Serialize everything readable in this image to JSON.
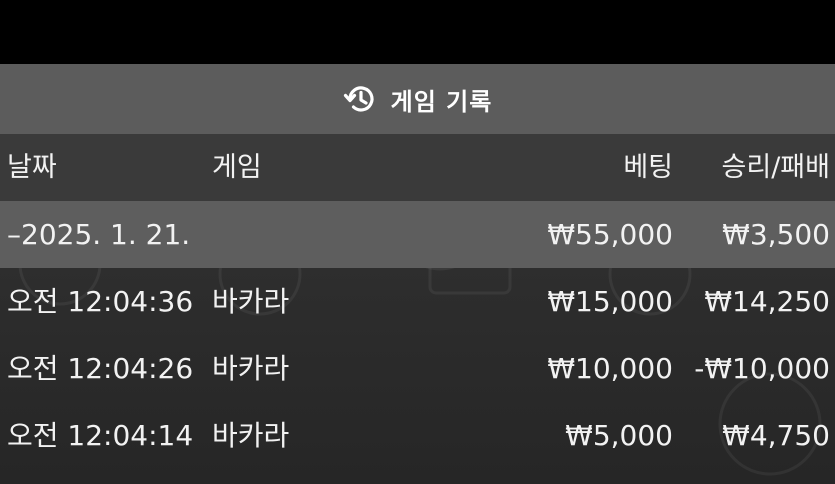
{
  "window": {
    "title": "게임 기록",
    "title_icon": "history-icon"
  },
  "table": {
    "headers": {
      "date": "날짜",
      "game": "게임",
      "bet": "베팅",
      "result": "승리/패배"
    },
    "date_group": {
      "label": "–2025. 1. 21.",
      "bet_total": "₩55,000",
      "result_total": "₩3,500"
    },
    "rows": [
      {
        "time": "오전 12:04:36",
        "game": "바카라",
        "bet": "₩15,000",
        "result": "₩14,250"
      },
      {
        "time": "오전 12:04:26",
        "game": "바카라",
        "bet": "₩10,000",
        "result": "-₩10,000"
      },
      {
        "time": "오전 12:04:14",
        "game": "바카라",
        "bet": "₩5,000",
        "result": "₩4,750"
      }
    ]
  },
  "colors": {
    "title_bar": "#5c5c5c",
    "group_row": "#5e5e5e",
    "text": "#f2f2f2"
  }
}
